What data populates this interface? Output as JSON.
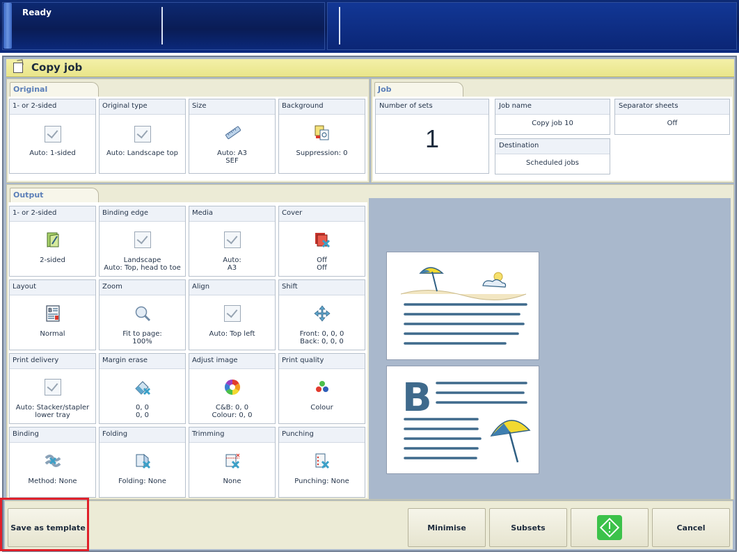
{
  "status": "Ready",
  "title": "Copy job",
  "original": {
    "tab": "Original",
    "tiles": [
      {
        "label": "1- or 2-sided",
        "value": "Auto: 1-sided",
        "icon": "checkbox-icon"
      },
      {
        "label": "Original type",
        "value": "Auto: Landscape top",
        "icon": "checkbox-icon"
      },
      {
        "label": "Size",
        "value": "Auto: A3",
        "value2": "SEF",
        "icon": "ruler-icon"
      },
      {
        "label": "Background",
        "value": "Suppression: 0",
        "icon": "background-icon"
      }
    ]
  },
  "job": {
    "tab": "Job",
    "number_of_sets_label": "Number of sets",
    "number_of_sets_value": "1",
    "job_name_label": "Job name",
    "job_name_value": "Copy job 10",
    "destination_label": "Destination",
    "destination_value": "Scheduled jobs",
    "separator_label": "Separator sheets",
    "separator_value": "Off"
  },
  "output": {
    "tab": "Output",
    "tiles": [
      {
        "label": "1- or 2-sided",
        "value": "2-sided",
        "value2": "",
        "icon": "duplex-icon"
      },
      {
        "label": "Binding edge",
        "value": "Landscape",
        "value2": "Auto: Top, head to toe",
        "icon": "checkbox-icon"
      },
      {
        "label": "Media",
        "value": "Auto:",
        "value2": "A3",
        "icon": "checkbox-icon"
      },
      {
        "label": "Cover",
        "value": "Off",
        "value2": "Off",
        "icon": "cover-icon"
      },
      {
        "label": "Layout",
        "value": "Normal",
        "value2": "",
        "icon": "layout-icon"
      },
      {
        "label": "Zoom",
        "value": "Fit to page:",
        "value2": "100%",
        "icon": "zoom-icon"
      },
      {
        "label": "Align",
        "value": "Auto: Top left",
        "value2": "",
        "icon": "checkbox-icon"
      },
      {
        "label": "Shift",
        "value": "Front: 0, 0, 0",
        "value2": "Back: 0, 0, 0",
        "icon": "shift-icon"
      },
      {
        "label": "Print delivery",
        "value": "Auto: Stacker/stapler",
        "value2": "lower tray",
        "icon": "checkbox-icon"
      },
      {
        "label": "Margin erase",
        "value": "0, 0",
        "value2": "0, 0",
        "icon": "eraser-icon"
      },
      {
        "label": "Adjust image",
        "value": "C&B: 0, 0",
        "value2": "Colour: 0, 0",
        "icon": "color-wheel-icon"
      },
      {
        "label": "Print quality",
        "value": "Colour",
        "value2": "",
        "icon": "print-quality-icon"
      },
      {
        "label": "Binding",
        "value": "Method: None",
        "value2": "",
        "icon": "binding-icon"
      },
      {
        "label": "Folding",
        "value": "Folding: None",
        "value2": "",
        "icon": "folding-icon"
      },
      {
        "label": "Trimming",
        "value": "None",
        "value2": "",
        "icon": "trimming-icon"
      },
      {
        "label": "Punching",
        "value": "Punching: None",
        "value2": "",
        "icon": "punching-icon"
      }
    ]
  },
  "footer": {
    "save_template": "Save as template",
    "minimise": "Minimise",
    "subsets": "Subsets",
    "start_icon": "start-icon",
    "cancel": "Cancel"
  },
  "colors": {
    "accent_green": "#3cc24a",
    "tab_text": "#5b7fb8",
    "highlight_red": "#e0202a",
    "preview_blue": "#3f6a8c"
  }
}
